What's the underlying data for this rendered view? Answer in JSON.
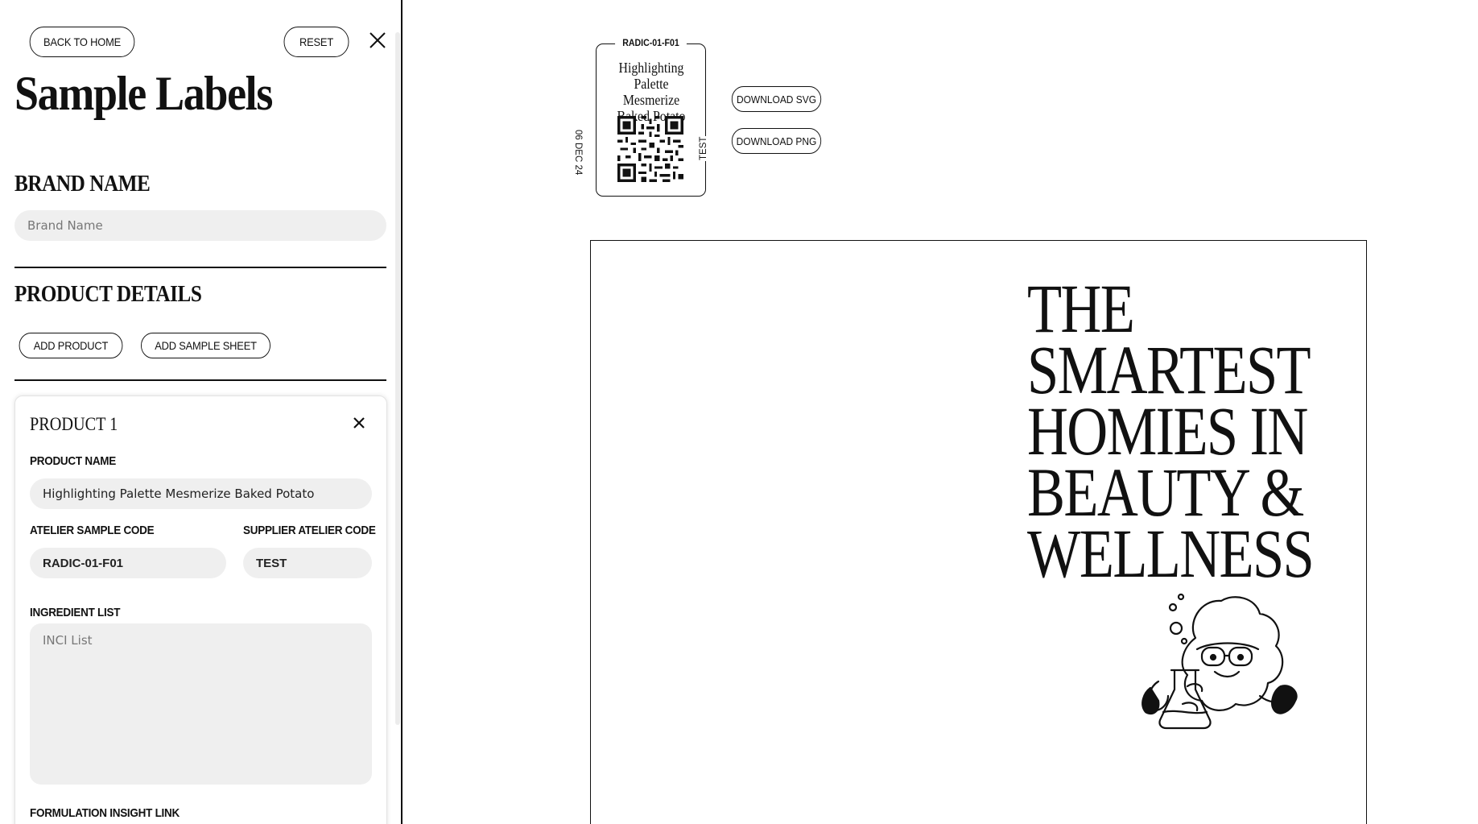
{
  "sidebar": {
    "back_button": "BACK TO HOME",
    "reset_button": "RESET",
    "title": "Sample Labels",
    "brand": {
      "heading": "BRAND NAME",
      "placeholder": "Brand Name",
      "value": ""
    },
    "product_details": {
      "heading": "PRODUCT DETAILS",
      "add_product": "ADD PRODUCT",
      "add_sample_sheet": "ADD SAMPLE SHEET"
    },
    "product_card": {
      "title": "PRODUCT 1",
      "product_name_label": "PRODUCT NAME",
      "product_name_value": "Highlighting Palette Mesmerize Baked Potato",
      "atelier_code_label": "ATELIER SAMPLE CODE",
      "atelier_code_value": "RADIC-01-F01",
      "supplier_code_label": "SUPPLIER ATELIER CODE",
      "supplier_code_value": "TEST",
      "ingredient_label": "INGREDIENT LIST",
      "ingredient_placeholder": "INCI List",
      "formulation_label": "FORMULATION INSIGHT LINK"
    }
  },
  "preview": {
    "label": {
      "code": "RADIC-01-F01",
      "name": "Highlighting Palette Mesmerize Baked Potato",
      "date": "06 DEC 24",
      "supplier": "TEST"
    },
    "download_svg": "DOWNLOAD SVG",
    "download_png": "DOWNLOAD PNG",
    "sheet": {
      "headline_lines": [
        "THE",
        "SMARTEST",
        "HOMIES IN",
        "BEAUTY &",
        "WELLNESS"
      ],
      "mascot_icon": "scientist-cloud-mascot-icon"
    }
  }
}
